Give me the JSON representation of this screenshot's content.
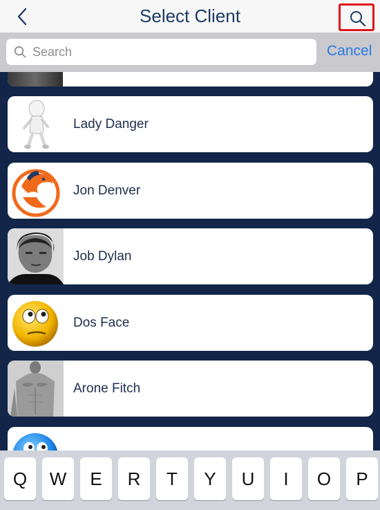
{
  "navbar": {
    "title": "Select Client"
  },
  "search": {
    "placeholder": "Search",
    "value": "",
    "cancel_label": "Cancel"
  },
  "clients": [
    {
      "name": "Lady Danger",
      "avatar": "white-figure-avatar"
    },
    {
      "name": "Jon Denver",
      "avatar": "bronco-logo-avatar"
    },
    {
      "name": "Job Dylan",
      "avatar": "portrait-photo-avatar"
    },
    {
      "name": "Dos Face",
      "avatar": "yellow-smiley-avatar"
    },
    {
      "name": "Arone Fitch",
      "avatar": "torso-photo-avatar"
    },
    {
      "name": "",
      "avatar": "blue-smiley-avatar"
    }
  ],
  "keyboard": {
    "row1": [
      "Q",
      "W",
      "E",
      "R",
      "T",
      "Y",
      "U",
      "I",
      "O",
      "P"
    ]
  },
  "colors": {
    "accent": "#2a7ae4",
    "highlight": "#e0131b",
    "background": "#13264a"
  }
}
